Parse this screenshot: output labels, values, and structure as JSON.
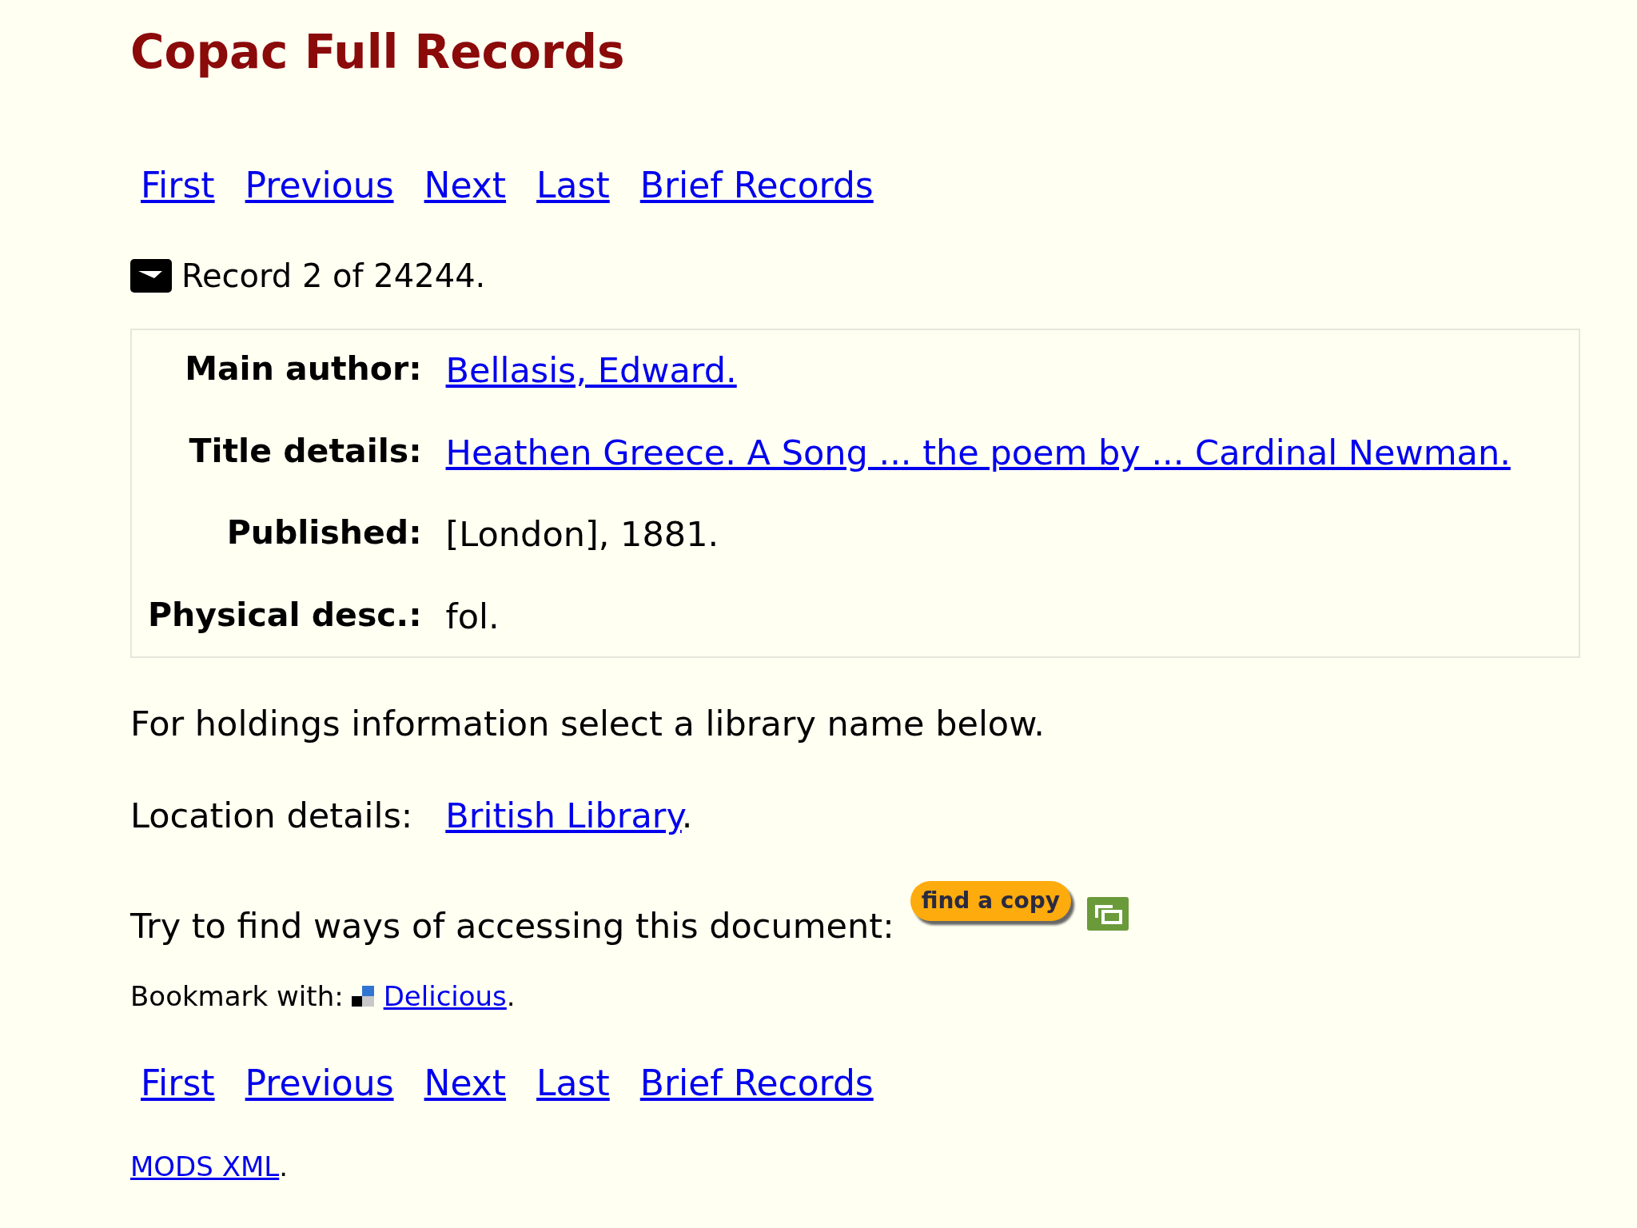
{
  "title": "Copac Full Records",
  "nav_top": [
    "First",
    "Previous",
    "Next",
    "Last",
    "Brief Records"
  ],
  "record_status": "Record 2 of 24244.",
  "fields": [
    {
      "label": "Main author:",
      "value": "Bellasis, Edward.",
      "kind": "link"
    },
    {
      "label": "Title details:",
      "value": "Heathen Greece. A Song ... the poem by ... Cardinal Newman.",
      "kind": "link"
    },
    {
      "label": "Published:",
      "value": "[London], 1881.",
      "kind": "text"
    },
    {
      "label": "Physical desc.:",
      "value": "fol.",
      "kind": "text"
    }
  ],
  "holdings_note": "For holdings information select a library name below.",
  "location": {
    "label": "Location details:",
    "library": "British Library",
    "end": "."
  },
  "access": {
    "text": "Try to find ways of accessing this document:",
    "button": "find a copy"
  },
  "bookmark": {
    "label": "Bookmark with:",
    "service": "Delicious",
    "end": "."
  },
  "nav_bottom": [
    "First",
    "Previous",
    "Next",
    "Last",
    "Brief Records"
  ],
  "mods": {
    "link": "MODS XML",
    "end": "."
  }
}
